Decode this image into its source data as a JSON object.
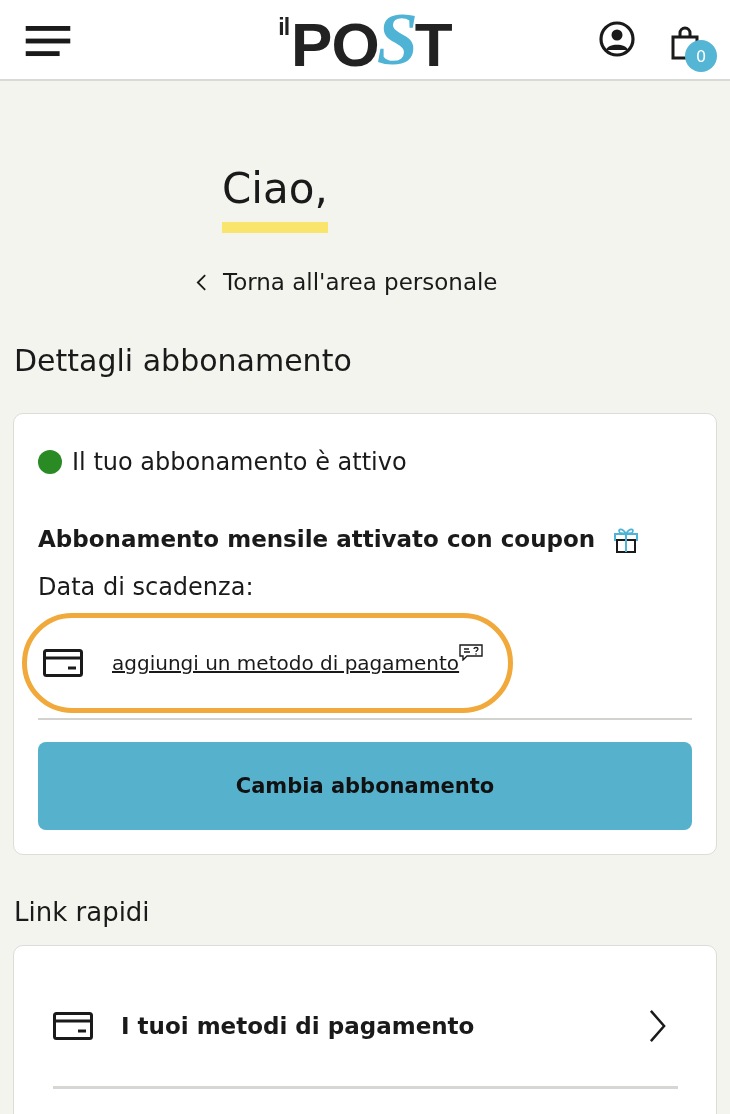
{
  "header": {
    "logo": {
      "prefix": "il",
      "parts": [
        {
          "text": "PO",
          "accent": false
        },
        {
          "text": "S",
          "accent": true
        },
        {
          "text": "T",
          "accent": false
        }
      ]
    },
    "cart_count": "0"
  },
  "greeting": "Ciao,",
  "back_link": "Torna all'area personale",
  "subscription": {
    "heading": "Dettagli abbonamento",
    "status": {
      "text": "Il tuo abbonamento è attivo",
      "active": true
    },
    "plan": "Abbonamento mensile attivato con coupon",
    "expiry_label": "Data di scadenza:",
    "payment_link": {
      "text": "aggiungi un metodo di pagamento",
      "highlighted": true
    },
    "button": "Cambia abbonamento"
  },
  "quick_links": {
    "heading": "Link rapidi",
    "items": [
      {
        "label": "I tuoi metodi di pagamento"
      }
    ]
  }
}
